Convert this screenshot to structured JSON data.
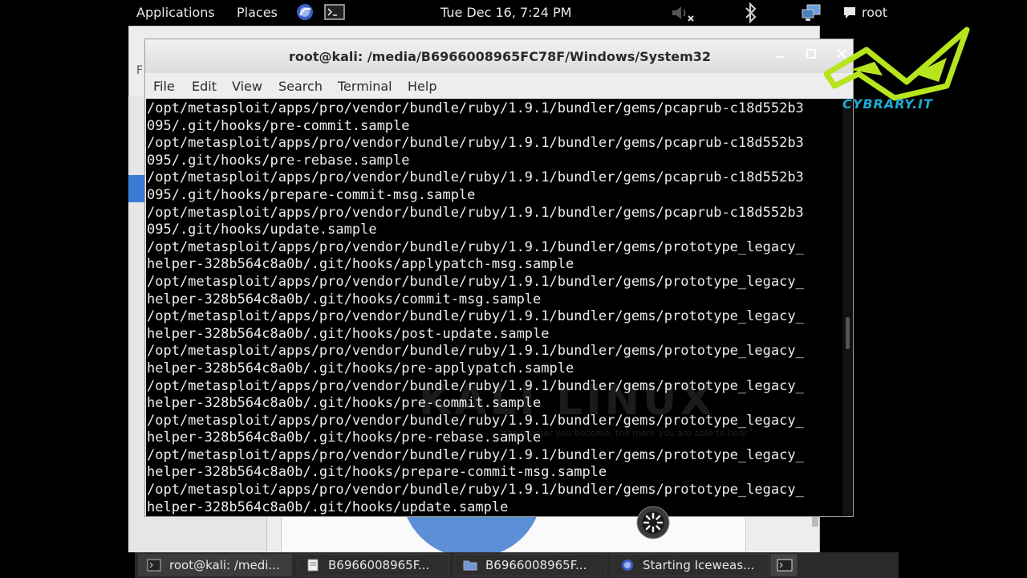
{
  "top_panel": {
    "applications": "Applications",
    "places": "Places",
    "clock": "Tue Dec 16,  7:24 PM",
    "user": "root"
  },
  "background_window": {
    "left_char": "F"
  },
  "terminal": {
    "title": "root@kali: /media/B6966008965FC78F/Windows/System32",
    "menu": [
      "File",
      "Edit",
      "View",
      "Search",
      "Terminal",
      "Help"
    ],
    "watermark": "KALI LINUX",
    "watermark_sub": "“the quieter you become, the more you are able to hear”",
    "lines": [
      "/opt/metasploit/apps/pro/vendor/bundle/ruby/1.9.1/bundler/gems/pcaprub-c18d552b3",
      "095/.git/hooks/pre-commit.sample",
      "/opt/metasploit/apps/pro/vendor/bundle/ruby/1.9.1/bundler/gems/pcaprub-c18d552b3",
      "095/.git/hooks/pre-rebase.sample",
      "/opt/metasploit/apps/pro/vendor/bundle/ruby/1.9.1/bundler/gems/pcaprub-c18d552b3",
      "095/.git/hooks/prepare-commit-msg.sample",
      "/opt/metasploit/apps/pro/vendor/bundle/ruby/1.9.1/bundler/gems/pcaprub-c18d552b3",
      "095/.git/hooks/update.sample",
      "/opt/metasploit/apps/pro/vendor/bundle/ruby/1.9.1/bundler/gems/prototype_legacy_",
      "helper-328b564c8a0b/.git/hooks/applypatch-msg.sample",
      "/opt/metasploit/apps/pro/vendor/bundle/ruby/1.9.1/bundler/gems/prototype_legacy_",
      "helper-328b564c8a0b/.git/hooks/commit-msg.sample",
      "/opt/metasploit/apps/pro/vendor/bundle/ruby/1.9.1/bundler/gems/prototype_legacy_",
      "helper-328b564c8a0b/.git/hooks/post-update.sample",
      "/opt/metasploit/apps/pro/vendor/bundle/ruby/1.9.1/bundler/gems/prototype_legacy_",
      "helper-328b564c8a0b/.git/hooks/pre-applypatch.sample",
      "/opt/metasploit/apps/pro/vendor/bundle/ruby/1.9.1/bundler/gems/prototype_legacy_",
      "helper-328b564c8a0b/.git/hooks/pre-commit.sample",
      "/opt/metasploit/apps/pro/vendor/bundle/ruby/1.9.1/bundler/gems/prototype_legacy_",
      "helper-328b564c8a0b/.git/hooks/pre-rebase.sample",
      "/opt/metasploit/apps/pro/vendor/bundle/ruby/1.9.1/bundler/gems/prototype_legacy_",
      "helper-328b564c8a0b/.git/hooks/prepare-commit-msg.sample",
      "/opt/metasploit/apps/pro/vendor/bundle/ruby/1.9.1/bundler/gems/prototype_legacy_",
      "helper-328b564c8a0b/.git/hooks/update.sample"
    ]
  },
  "logo": {
    "text": "CYBRARY.IT"
  },
  "taskbar": {
    "items": [
      {
        "label": "root@kali: /medi...",
        "icon": "terminal-icon"
      },
      {
        "label": "B6966008965F...",
        "icon": "folder-icon"
      },
      {
        "label": "B6966008965F...",
        "icon": "folder-icon"
      },
      {
        "label": "Starting Iceweas...",
        "icon": "iceweasel-icon"
      }
    ]
  },
  "colors": {
    "terminal_bg": "#000000",
    "terminal_fg": "#ececec",
    "logo_green": "#b6e51e",
    "logo_blue": "#1fa9d6"
  }
}
